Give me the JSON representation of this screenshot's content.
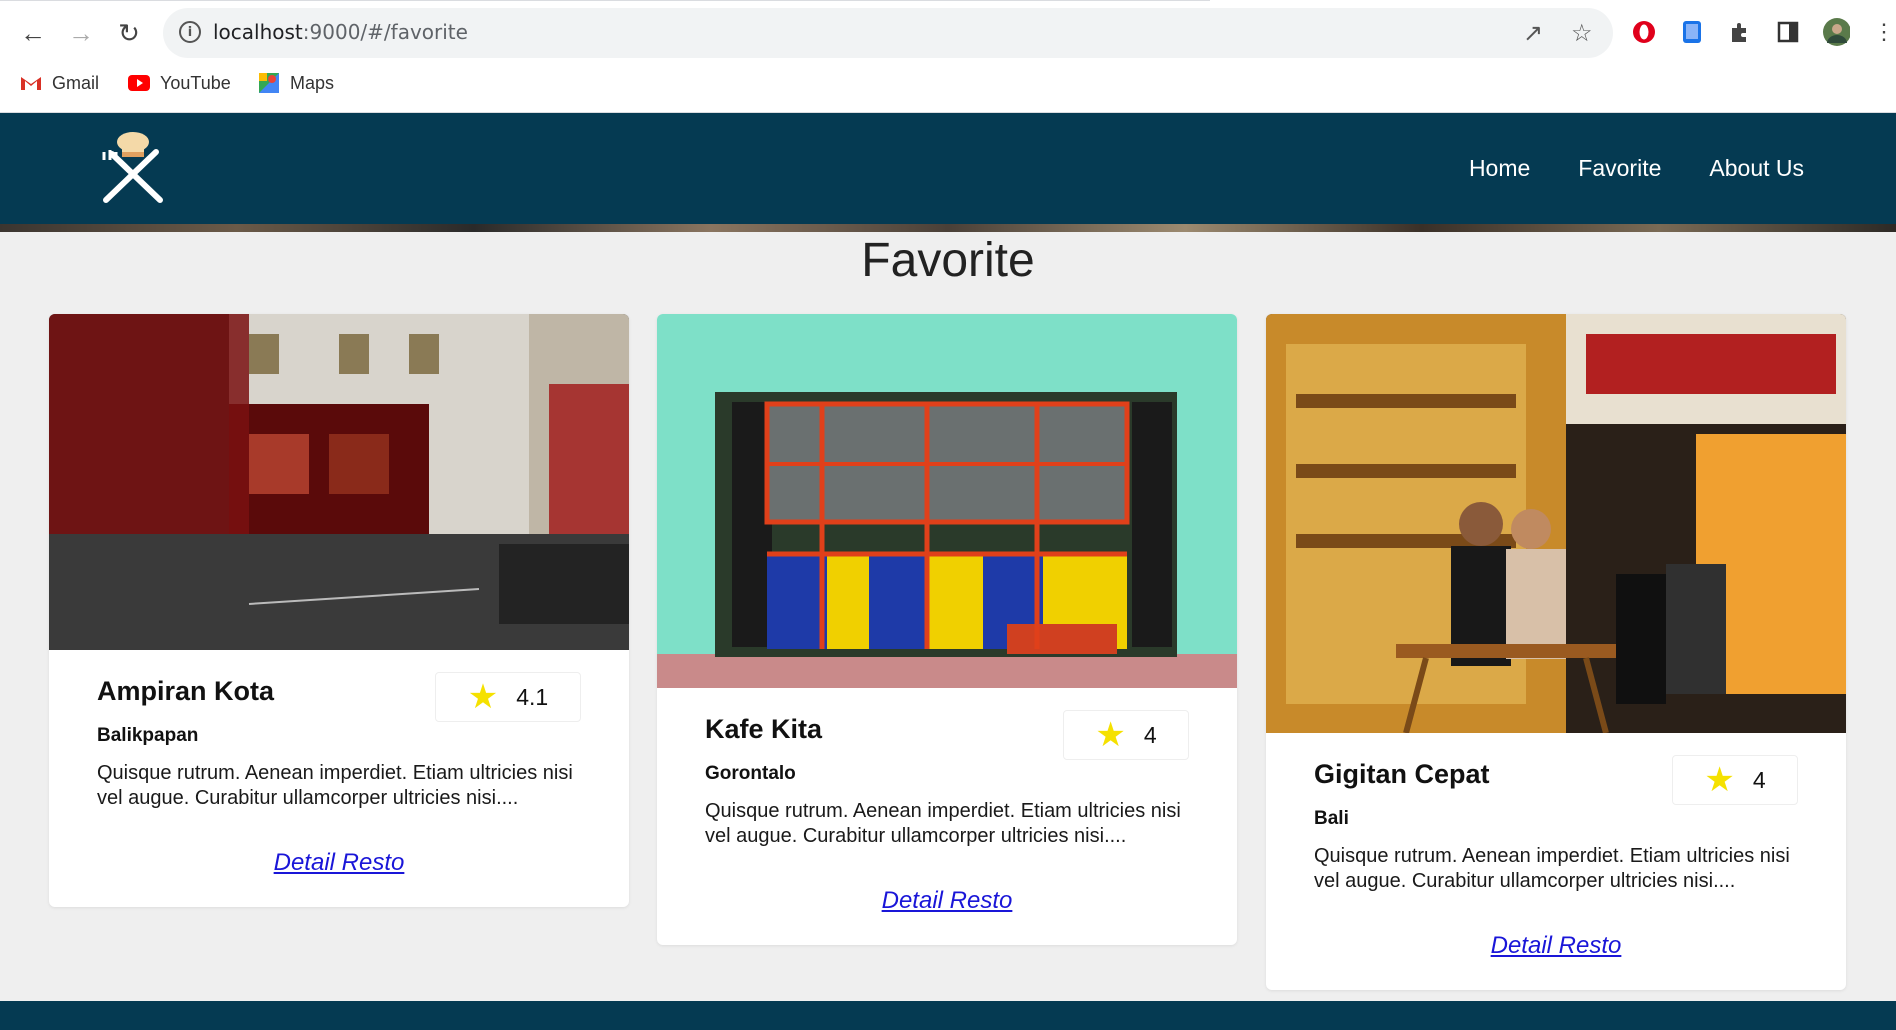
{
  "browser": {
    "url_host": "localhost",
    "url_path": ":9000/#/favorite",
    "bookmarks": [
      {
        "label": "Gmail",
        "icon": "gmail-icon"
      },
      {
        "label": "YouTube",
        "icon": "youtube-icon"
      },
      {
        "label": "Maps",
        "icon": "maps-icon"
      }
    ]
  },
  "nav": {
    "items": [
      "Home",
      "Favorite",
      "About Us"
    ]
  },
  "page": {
    "title": "Favorite"
  },
  "restaurants": [
    {
      "name": "Ampiran Kota",
      "city": "Balikpapan",
      "rating": "4.1",
      "description": "Quisque rutrum. Aenean imperdiet. Etiam ultricies nisi vel augue. Curabitur ullamcorper ultricies nisi....",
      "link": "Detail Resto"
    },
    {
      "name": "Kafe Kita",
      "city": "Gorontalo",
      "rating": "4",
      "description": "Quisque rutrum. Aenean imperdiet. Etiam ultricies nisi vel augue. Curabitur ullamcorper ultricies nisi....",
      "link": "Detail Resto"
    },
    {
      "name": "Gigitan Cepat",
      "city": "Bali",
      "rating": "4",
      "description": "Quisque rutrum. Aenean imperdiet. Etiam ultricies nisi vel augue. Curabitur ullamcorper ultricies nisi....",
      "link": "Detail Resto"
    }
  ],
  "colors": {
    "header": "#053a52",
    "background": "#efefef",
    "star": "#f5e100",
    "link": "#1a16d8"
  }
}
